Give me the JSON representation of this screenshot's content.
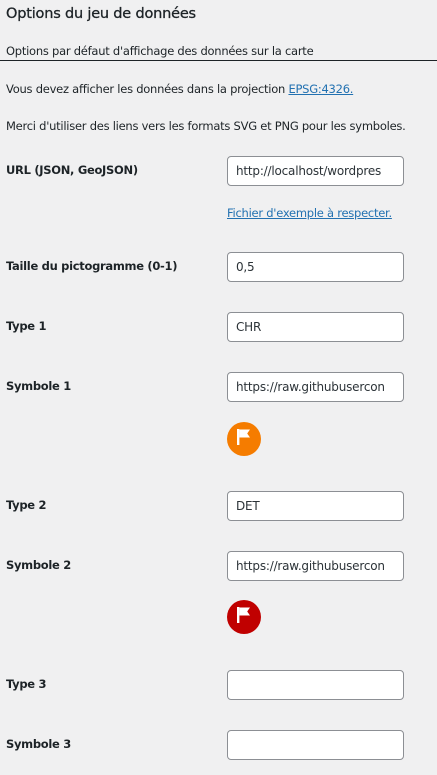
{
  "section": {
    "title": "Options du jeu de données",
    "subtitle": "Options par défaut d'affichage des données sur la carte"
  },
  "notice": {
    "projection_text": "Vous devez afficher les données dans la projection ",
    "projection_link": "EPSG:4326.",
    "formats_text": "Merci d'utiliser des liens vers les formats SVG et PNG pour les symboles."
  },
  "fields": {
    "url": {
      "label": "URL (JSON, GeoJSON)",
      "value": "http://localhost/wordpres"
    },
    "example_link": "Fichier d'exemple à respecter.",
    "size": {
      "label": "Taille du pictogramme (0-1)",
      "value": "0,5"
    },
    "type1": {
      "label": "Type 1",
      "value": "CHR"
    },
    "symbol1": {
      "label": "Symbole 1",
      "value": "https://raw.githubusercon"
    },
    "type2": {
      "label": "Type 2",
      "value": "DET"
    },
    "symbol2": {
      "label": "Symbole 2",
      "value": "https://raw.githubusercon"
    },
    "type3": {
      "label": "Type 3",
      "value": ""
    },
    "symbol3": {
      "label": "Symbole 3",
      "value": ""
    }
  },
  "icons": {
    "symbol1": {
      "name": "flag-icon",
      "color": "#f57c00"
    },
    "symbol2": {
      "name": "flag-icon",
      "color": "#c00000"
    }
  }
}
